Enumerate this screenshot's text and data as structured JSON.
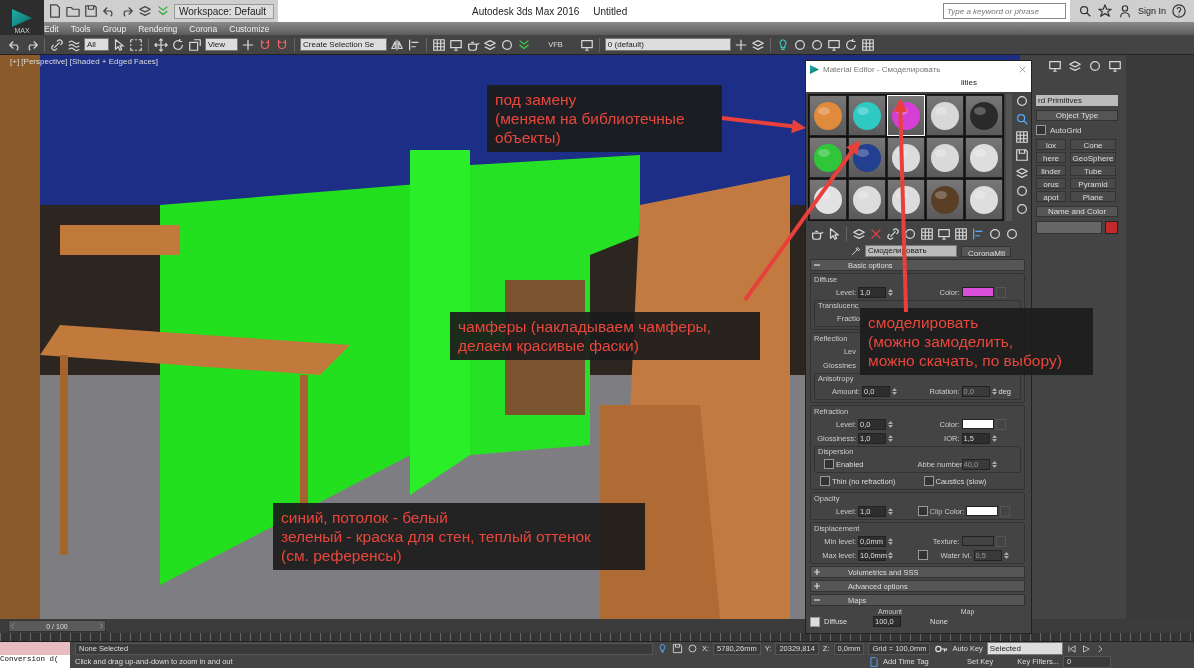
{
  "title_bar": {
    "logo": "MAX",
    "workspace": "Workspace: Default",
    "app_title": "Autodesk 3ds Max 2016",
    "doc_title": "Untitled",
    "search": {
      "placeholder": "Type a keyword or phrase"
    },
    "sign_in": "Sign In"
  },
  "menu": [
    "Edit",
    "Tools",
    "Group",
    "Rendering",
    "Corona",
    "Customize"
  ],
  "toolbar": {
    "selection_filter": "All",
    "coord_system": "View",
    "selection_set": "Create Selection Se",
    "vfb": "VFB",
    "layer": "0 (default)"
  },
  "viewport": {
    "label": "[+] [Perspective] [Shaded + Edged Faces]"
  },
  "command_panel": {
    "category": "rd Primitives",
    "rollout": "Object Type",
    "autogrid": {
      "label": "AutoGrid",
      "checked": false
    },
    "buttons": [
      "lox",
      "Cone",
      "here",
      "GeoSphere",
      "linder",
      "Tube",
      "orus",
      "Pyramid",
      "apot",
      "Plane"
    ],
    "name_color": {
      "title": "Name and Color",
      "color": "#c42a2a"
    }
  },
  "material_editor": {
    "title": "Material Editor - Смоделировать",
    "menu": "lities",
    "slots": [
      {
        "color": "#e08a3c",
        "selected": false
      },
      {
        "color": "#2fc9c4",
        "selected": false
      },
      {
        "color": "#d63fd6",
        "selected": true
      },
      {
        "color": "#d8d8d8",
        "selected": false
      },
      {
        "color": "#2a2a2a",
        "selected": false
      },
      {
        "color": "#2fc63a",
        "selected": false
      },
      {
        "color": "#233f8f",
        "selected": false
      },
      {
        "color": "#dcdcdc",
        "selected": false
      },
      {
        "color": "#dadada",
        "selected": false
      },
      {
        "color": "#dedede",
        "selected": false
      },
      {
        "color": "#e2e2e2",
        "selected": false
      },
      {
        "color": "#dcdcdc",
        "selected": false
      },
      {
        "color": "#dddddd",
        "selected": false
      },
      {
        "color": "#5a3e26",
        "selected": false
      },
      {
        "color": "#dedede",
        "selected": false
      }
    ],
    "material_name": "Смоделировать",
    "material_type": "CoronaMtl",
    "rollouts": [
      {
        "title": "Basic options",
        "expanded": true,
        "groups": [
          {
            "title": "Diffuse",
            "rows": [
              {
                "kind": "fields",
                "fields": [
                  {
                    "kind": "spinner",
                    "label": "Level:",
                    "value": "1,0"
                  },
                  {
                    "kind": "swatch",
                    "label": "Color:",
                    "color": "#d94fd9"
                  }
                ]
              },
              {
                "kind": "subgroup",
                "title": "Translucenc",
                "rows": [
                  {
                    "kind": "fields",
                    "fields": [
                      {
                        "kind": "label",
                        "label": "Fractio"
                      }
                    ]
                  }
                ]
              }
            ]
          },
          {
            "title": "Reflection",
            "rows": [
              {
                "kind": "fields",
                "fields": [
                  {
                    "kind": "label",
                    "label": "Lev"
                  }
                ]
              },
              {
                "kind": "fields",
                "fields": [
                  {
                    "kind": "label",
                    "label": "Glossines"
                  }
                ]
              },
              {
                "kind": "subgroup",
                "title": "Anisotropy",
                "rows": [
                  {
                    "kind": "fields",
                    "fields": [
                      {
                        "kind": "spinner",
                        "label": "Amount:",
                        "value": "0,0"
                      },
                      {
                        "kind": "spinner",
                        "label": "Rotation:",
                        "value": "0,0",
                        "disabled": true,
                        "suffix": "deg"
                      }
                    ]
                  }
                ]
              }
            ]
          },
          {
            "title": "Refraction",
            "rows": [
              {
                "kind": "fields",
                "fields": [
                  {
                    "kind": "spinner",
                    "label": "Level:",
                    "value": "0,0"
                  },
                  {
                    "kind": "swatch",
                    "label": "Color:",
                    "color": "#ffffff"
                  }
                ]
              },
              {
                "kind": "fields",
                "fields": [
                  {
                    "kind": "spinner",
                    "label": "Glossiness:",
                    "value": "1,0"
                  },
                  {
                    "kind": "spinner",
                    "label": "IOR:",
                    "value": "1,5"
                  }
                ]
              },
              {
                "kind": "subgroup",
                "title": "Dispersion",
                "rows": [
                  {
                    "kind": "fields",
                    "fields": [
                      {
                        "kind": "checkbox",
                        "label": "Enabled",
                        "checked": false
                      },
                      {
                        "kind": "spinner",
                        "label": "Abbe number:",
                        "value": "40,0",
                        "disabled": true
                      }
                    ]
                  }
                ]
              },
              {
                "kind": "fields",
                "fields": [
                  {
                    "kind": "checkbox",
                    "label": "Thin (no refraction)",
                    "checked": false
                  },
                  {
                    "kind": "checkbox",
                    "label": "Caustics (slow)",
                    "checked": false
                  }
                ]
              }
            ]
          },
          {
            "title": "Opacity",
            "rows": [
              {
                "kind": "fields",
                "fields": [
                  {
                    "kind": "spinner",
                    "label": "Level:",
                    "value": "1,0"
                  },
                  {
                    "kind": "swatch",
                    "label": "Color:",
                    "color": "#ffffff",
                    "clip": {
                      "label": "Clip",
                      "checked": false
                    }
                  }
                ]
              }
            ]
          },
          {
            "title": "Displacement",
            "rows": [
              {
                "kind": "fields",
                "fields": [
                  {
                    "kind": "spinner",
                    "label": "Min level:",
                    "value": "0,0mm"
                  },
                  {
                    "kind": "swatch",
                    "label": "Texture:",
                    "color": "#444444"
                  }
                ]
              },
              {
                "kind": "fields",
                "fields": [
                  {
                    "kind": "spinner",
                    "label": "Max level:",
                    "value": "10,0mm"
                  },
                  {
                    "kind": "spinner",
                    "label": "Water lvl.",
                    "value": "0,5",
                    "disabled": true,
                    "check": {
                      "checked": false
                    }
                  }
                ]
              }
            ]
          }
        ]
      },
      {
        "title": "Volumetrics and SSS",
        "expanded": false
      },
      {
        "title": "Advanced options",
        "expanded": false
      },
      {
        "title": "Maps",
        "expanded": true,
        "maps": {
          "columns": [
            "Amount",
            "Map"
          ],
          "rows": [
            {
              "label": "Diffuse",
              "checked": true,
              "amount": "100,0",
              "map": "None"
            }
          ]
        }
      }
    ]
  },
  "annotations": [
    "под замену\n(меняем на библиотечные\nобъекты)",
    "чамферы (накладываем чамферы,\nделаем красивые фаски)",
    "смоделировать\n(можно замоделить,\nможно скачать, по выбору)",
    "синий, потолок - белый\nзеленый - краска для стен, теплый оттенок\n(см. референсы)"
  ],
  "time_slider": {
    "label": "0 / 100",
    "level": 0
  },
  "status_bar": {
    "script_output": "Conversion d(",
    "selection": "None Selected",
    "prompt": "Click and drag up-and-down to zoom in and out",
    "coordinates": [
      {
        "axis": "X:",
        "value": "5780,26mm"
      },
      {
        "axis": "Y:",
        "value": "20329,814"
      },
      {
        "axis": "Z:",
        "value": "0,0mm"
      }
    ],
    "grid": "Grid = 100,0mm",
    "add_time_tag": "Add Time Tag",
    "auto_key": "Auto Key",
    "key_mode": "Selected",
    "set_key": "Set Key",
    "key_filters": "Key Filters...",
    "frame": "0"
  }
}
